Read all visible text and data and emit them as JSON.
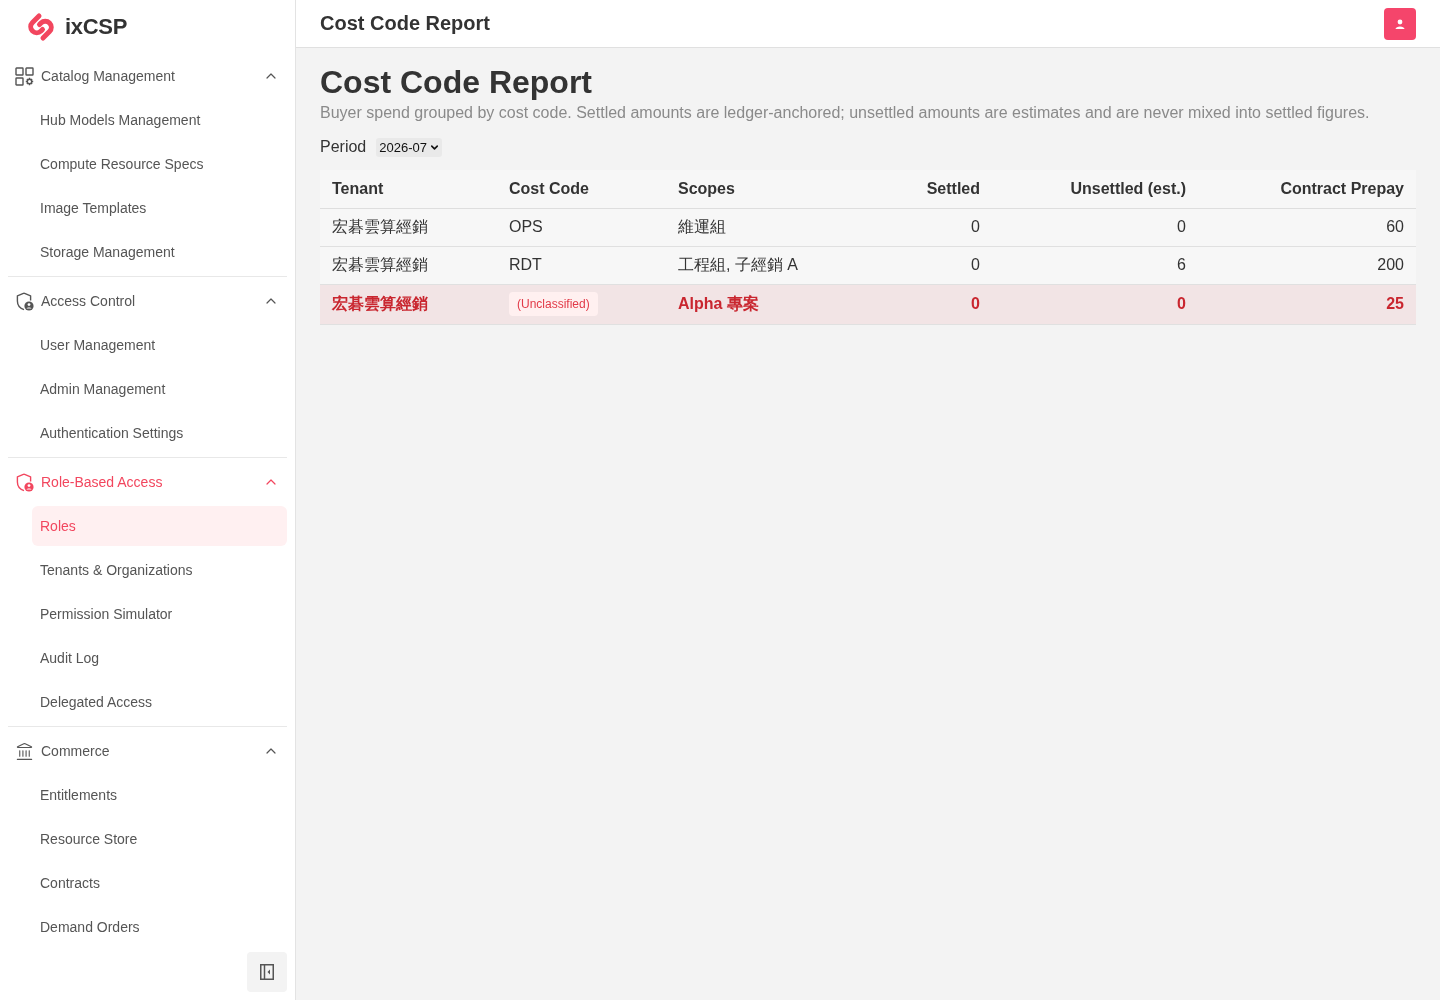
{
  "logo": {
    "text": "ixCSP"
  },
  "sidebar": {
    "groups": [
      {
        "label": "Catalog Management",
        "expanded": true,
        "active": false,
        "items": [
          {
            "label": "Hub Models Management",
            "selected": false
          },
          {
            "label": "Compute Resource Specs",
            "selected": false
          },
          {
            "label": "Image Templates",
            "selected": false
          },
          {
            "label": "Storage Management",
            "selected": false
          }
        ]
      },
      {
        "label": "Access Control",
        "expanded": true,
        "active": false,
        "items": [
          {
            "label": "User Management",
            "selected": false
          },
          {
            "label": "Admin Management",
            "selected": false
          },
          {
            "label": "Authentication Settings",
            "selected": false
          }
        ]
      },
      {
        "label": "Role-Based Access",
        "expanded": true,
        "active": true,
        "items": [
          {
            "label": "Roles",
            "selected": true
          },
          {
            "label": "Tenants & Organizations",
            "selected": false
          },
          {
            "label": "Permission Simulator",
            "selected": false
          },
          {
            "label": "Audit Log",
            "selected": false
          },
          {
            "label": "Delegated Access",
            "selected": false
          }
        ]
      },
      {
        "label": "Commerce",
        "expanded": true,
        "active": false,
        "items": [
          {
            "label": "Entitlements",
            "selected": false
          },
          {
            "label": "Resource Store",
            "selected": false
          },
          {
            "label": "Contracts",
            "selected": false
          },
          {
            "label": "Demand Orders",
            "selected": false
          }
        ]
      }
    ]
  },
  "header": {
    "title": "Cost Code Report"
  },
  "page": {
    "title": "Cost Code Report",
    "description": "Buyer spend grouped by cost code. Settled amounts are ledger-anchored; unsettled amounts are estimates and are never mixed into settled figures.",
    "period": {
      "label": "Period",
      "value": "2026-07"
    }
  },
  "table": {
    "columns": [
      {
        "label": "Tenant",
        "kind": "text"
      },
      {
        "label": "Cost Code",
        "kind": "text"
      },
      {
        "label": "Scopes",
        "kind": "text"
      },
      {
        "label": "Settled",
        "kind": "number"
      },
      {
        "label": "Unsettled (est.)",
        "kind": "number"
      },
      {
        "label": "Contract Prepay",
        "kind": "number"
      }
    ],
    "rows": [
      {
        "tenant": "宏碁雲算經銷",
        "cost_code": "OPS",
        "unclassified": false,
        "scopes": "維運組",
        "settled": "0",
        "unsettled": "0",
        "contract_prepay": "60",
        "highlighted": false
      },
      {
        "tenant": "宏碁雲算經銷",
        "cost_code": "RDT",
        "unclassified": false,
        "scopes": "工程組, 子經銷 A",
        "settled": "0",
        "unsettled": "6",
        "contract_prepay": "200",
        "highlighted": false
      },
      {
        "tenant": "宏碁雲算經銷",
        "cost_code": "(Unclassified)",
        "unclassified": true,
        "scopes": "Alpha 專案",
        "settled": "0",
        "unsettled": "0",
        "contract_prepay": "25",
        "highlighted": true
      }
    ]
  }
}
